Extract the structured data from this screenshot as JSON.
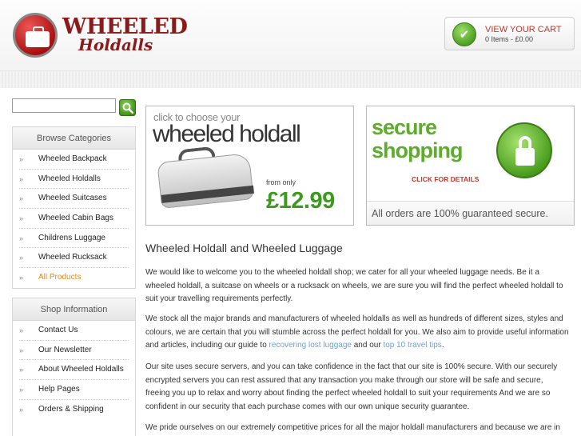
{
  "header": {
    "logo": {
      "title": "WHEELED",
      "subtitle": "Holdalls"
    },
    "cart": {
      "title": "VIEW YOUR CART",
      "summary": "0 Items - £0.00"
    }
  },
  "search": {
    "value": "",
    "button_icon": "search-icon"
  },
  "categories": {
    "title": "Browse Categories",
    "items": [
      {
        "label": "Wheeled Backpack"
      },
      {
        "label": "Wheeled Holdalls"
      },
      {
        "label": "Wheeled Suitcases"
      },
      {
        "label": "Wheeled Cabin Bags"
      },
      {
        "label": "Childrens Luggage"
      },
      {
        "label": "Wheeled Rucksack"
      },
      {
        "label": "All Products"
      }
    ]
  },
  "shop_info": {
    "title": "Shop Information",
    "items": [
      {
        "label": "Contact Us"
      },
      {
        "label": "Our Newsletter"
      },
      {
        "label": "About Wheeled Holdalls"
      },
      {
        "label": "Help Pages"
      },
      {
        "label": "Orders & Shipping"
      }
    ]
  },
  "banners": {
    "holdall": {
      "small": "click to choose your",
      "big": "wheeled holdall",
      "from": "from only",
      "price": "£12.99"
    },
    "secure": {
      "line1": "secure",
      "line2": "shopping",
      "click": "CLICK FOR DETAILS",
      "footer": "All orders are 100% guaranteed secure."
    }
  },
  "main": {
    "title": "Wheeled Holdall and Wheeled Luggage",
    "p1": "We would like to welcome you to the wheeled holdall shop; we cater for all your wheeled luggage needs. Be it a wheeled holdall, a suitcase on wheels or a rucksack on wheels, we are sure you will find the perfect wheeled holdall to suit your travelling requirements perfectly.",
    "p2_before": "We stock all the major brands and manufacturers of wheeled holdalls as well as hundreds of different sizes, styles and colours, we are certain that you will stumble across the perfect holdall for you. We also aim to provide useful information and articles, including our guide to ",
    "p2_link1": "recovering lost luggage",
    "p2_mid": " and our ",
    "p2_link2": "top 10 travel tips",
    "p2_after": ".",
    "p3": "Our site uses secure servers, and you can take confidence in the fact that our site is 100% secure. With our securely encrypted servers you can rest assured that any transaction you make through our store will be safe and secure, freeing you up to relax and worry about finding the perfect wheeled holdall to suit your requirements And we are so confident in our security that each purchase comes with our own unique security guarantee.",
    "p4": "We pride ourselves on our extremely competitive prices for all the major holdall manufacturers and because we are in"
  },
  "colors": {
    "accent_green": "#3d9a1e",
    "brand_red": "#8b1a1a",
    "active_orange": "#e08a1e",
    "link_blue": "#6aa3cf"
  }
}
